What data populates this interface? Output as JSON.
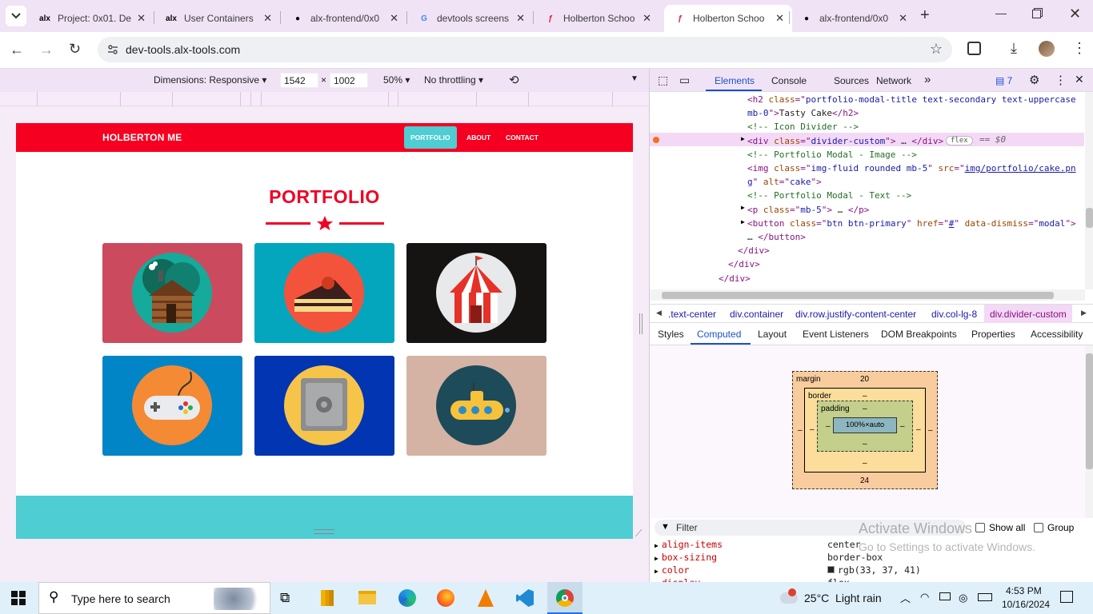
{
  "browser": {
    "tabs": [
      {
        "title": "Project: 0x01. De",
        "favicon": "alx-icon",
        "active": false
      },
      {
        "title": "User Containers",
        "favicon": "alx-icon",
        "active": false
      },
      {
        "title": "alx-frontend/0x0",
        "favicon": "github-icon",
        "active": false
      },
      {
        "title": "devtools screens",
        "favicon": "google-icon",
        "active": false
      },
      {
        "title": "Holberton Schoo",
        "favicon": "holberton-icon",
        "active": false
      },
      {
        "title": "Holberton Schoo",
        "favicon": "holberton-icon",
        "active": true
      },
      {
        "title": "alx-frontend/0x0",
        "favicon": "github-icon",
        "active": false
      }
    ],
    "url": "dev-tools.alx-tools.com"
  },
  "device_toolbar": {
    "dimensions_label": "Dimensions: Responsive",
    "width": "1542",
    "times": "×",
    "height": "1002",
    "zoom": "50%",
    "throttling": "No throttling"
  },
  "site": {
    "brand": "HOLBERTON ME",
    "nav": [
      "PORTFOLIO",
      "ABOUT",
      "CONTACT"
    ],
    "section_title": "PORTFOLIO",
    "portfolio_items": [
      {
        "name": "cabin",
        "bg": "#cc4a5e"
      },
      {
        "name": "cake",
        "bg": "#03a6bd"
      },
      {
        "name": "circus",
        "bg": "#161313"
      },
      {
        "name": "game",
        "bg": "#0285c6"
      },
      {
        "name": "safe",
        "bg": "#0235b1"
      },
      {
        "name": "submarine",
        "bg": "#d4b3a5"
      }
    ],
    "accent": "#f50020",
    "teal": "#4ecdd3"
  },
  "devtools": {
    "tabs": [
      "Elements",
      "Console",
      "Sources",
      "Network"
    ],
    "more": "»",
    "issues_count": "7",
    "elements_lines": [
      {
        "indent": 122,
        "parts": [
          [
            "tg",
            "<h2 "
          ],
          [
            "at",
            "class"
          ],
          [
            "tg",
            "=\""
          ],
          [
            "av",
            "portfolio-modal-title text-secondary text-uppercase"
          ]
        ]
      },
      {
        "indent": 122,
        "parts": [
          [
            "av",
            "mb-0"
          ],
          [
            "tg",
            "\">"
          ],
          [
            "tx",
            "Tasty Cake"
          ],
          [
            "tg",
            "</h2>"
          ]
        ]
      },
      {
        "indent": 122,
        "parts": [
          [
            "cm",
            "<!-- Icon Divider -->"
          ]
        ]
      },
      {
        "indent": 122,
        "parts": [
          [
            "tg",
            "<div "
          ],
          [
            "at",
            "class"
          ],
          [
            "tg",
            "=\""
          ],
          [
            "av",
            "divider-custom"
          ],
          [
            "tg",
            "\">"
          ],
          [
            "tx",
            " … "
          ],
          [
            "tg",
            "</div>"
          ]
        ]
      },
      {
        "indent": 122,
        "parts": [
          [
            "cm",
            "<!-- Portfolio Modal - Image -->"
          ]
        ]
      },
      {
        "indent": 122,
        "parts": [
          [
            "tg",
            "<img "
          ],
          [
            "at",
            "class"
          ],
          [
            "tg",
            "=\""
          ],
          [
            "av",
            "img-fluid rounded mb-5"
          ],
          [
            "tg",
            "\" "
          ],
          [
            "at",
            "src"
          ],
          [
            "tg",
            "=\""
          ],
          [
            "av",
            "img/portfolio/cake.pn"
          ]
        ]
      },
      {
        "indent": 122,
        "parts": [
          [
            "av",
            "g"
          ],
          [
            "tg",
            "\" "
          ],
          [
            "at",
            "alt"
          ],
          [
            "tg",
            "=\""
          ],
          [
            "av",
            "cake"
          ],
          [
            "tg",
            "\">"
          ]
        ]
      },
      {
        "indent": 122,
        "parts": [
          [
            "cm",
            "<!-- Portfolio Modal - Text -->"
          ]
        ]
      },
      {
        "indent": 122,
        "parts": [
          [
            "tg",
            "<p "
          ],
          [
            "at",
            "class"
          ],
          [
            "tg",
            "=\""
          ],
          [
            "av",
            "mb-5"
          ],
          [
            "tg",
            "\">"
          ],
          [
            "tx",
            " … "
          ],
          [
            "tg",
            "</p>"
          ]
        ]
      },
      {
        "indent": 122,
        "parts": [
          [
            "tg",
            "<button "
          ],
          [
            "at",
            "class"
          ],
          [
            "tg",
            "=\""
          ],
          [
            "av",
            "btn btn-primary"
          ],
          [
            "tg",
            "\" "
          ],
          [
            "at",
            "href"
          ],
          [
            "tg",
            "=\""
          ],
          [
            "av",
            "#"
          ],
          [
            "tg",
            "\" "
          ],
          [
            "at",
            "data-dismiss"
          ],
          [
            "tg",
            "=\""
          ],
          [
            "av",
            "modal"
          ],
          [
            "tg",
            "\">"
          ]
        ]
      },
      {
        "indent": 122,
        "parts": [
          [
            "tx",
            " … "
          ],
          [
            "tg",
            "</button>"
          ]
        ]
      },
      {
        "indent": 110,
        "parts": [
          [
            "tg",
            "</div>"
          ]
        ]
      },
      {
        "indent": 98,
        "parts": [
          [
            "tg",
            "</div>"
          ]
        ]
      },
      {
        "indent": 86,
        "parts": [
          [
            "tg",
            "</div>"
          ]
        ]
      }
    ],
    "selected_suffix": "== $0",
    "flex_badge": "flex",
    "breadcrumbs": [
      ".text-center",
      "div.container",
      "div.row.justify-content-center",
      "div.col-lg-8",
      "div.divider-custom"
    ],
    "subtabs": [
      "Styles",
      "Computed",
      "Layout",
      "Event Listeners",
      "DOM Breakpoints",
      "Properties",
      "Accessibility"
    ],
    "box_model": {
      "margin_label": "margin",
      "margin_top": "20",
      "margin_bottom": "24",
      "margin_side": "–",
      "border_label": "border",
      "border_val": "–",
      "padding_label": "padding",
      "padding_val": "–",
      "content": "100%×auto"
    },
    "filter_placeholder": "Filter",
    "show_all": "Show all",
    "group": "Group",
    "computed_props": [
      {
        "name": "align-items",
        "value": "center"
      },
      {
        "name": "box-sizing",
        "value": "border-box"
      },
      {
        "name": "color",
        "value": "rgb(33, 37, 41)"
      },
      {
        "name": "display",
        "value": "flex"
      }
    ],
    "watermark_title": "Activate Windows",
    "watermark_sub": "Go to Settings to activate Windows."
  },
  "taskbar": {
    "search_placeholder": "Type here to search",
    "weather": "25°C  Light rain",
    "time": "4:53 PM",
    "date": "10/16/2024"
  }
}
